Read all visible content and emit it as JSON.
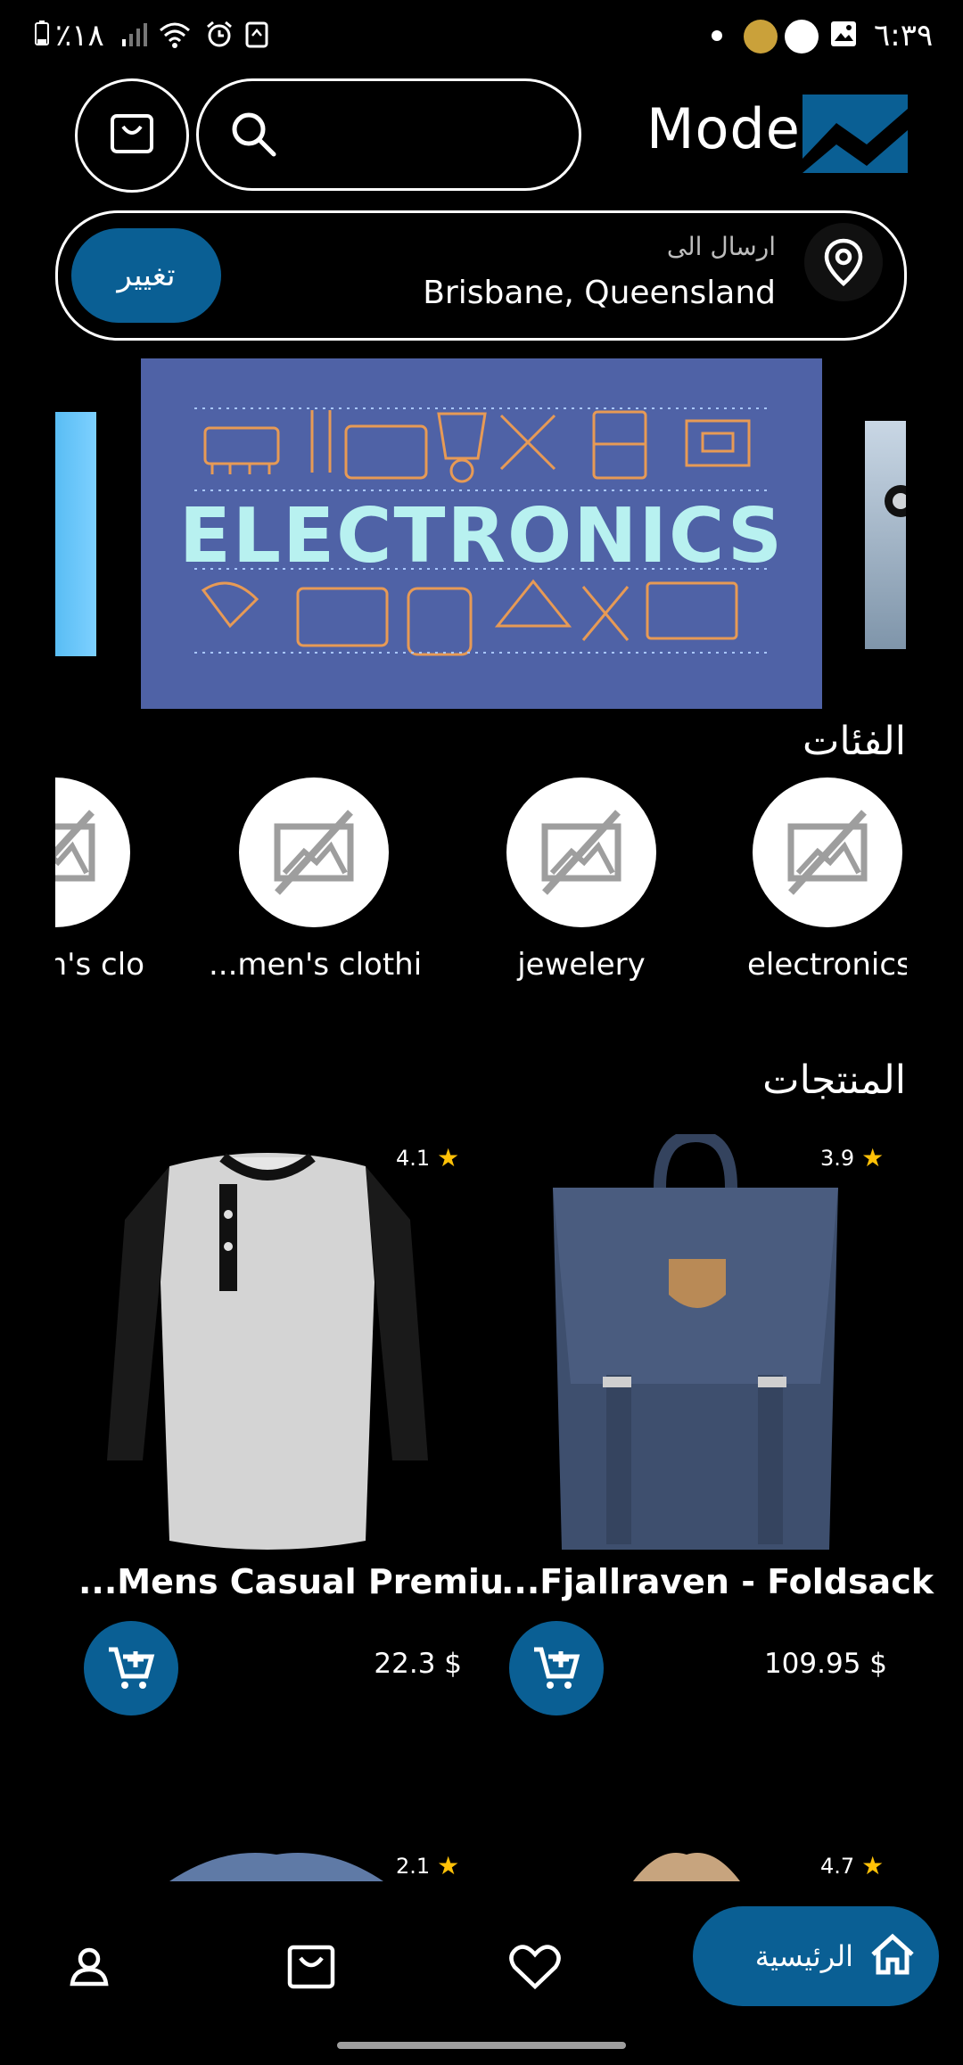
{
  "status": {
    "battery": "٪١٨",
    "time": "٦:٣٩"
  },
  "header": {
    "brand": "Modee",
    "search_placeholder": ""
  },
  "location": {
    "label": "ارسال الى",
    "address": "Brisbane, Queensland",
    "change_label": "تغيير"
  },
  "banner": {
    "title": "ELECTRONICS"
  },
  "sections": {
    "categories_title": "الفئات",
    "products_title": "المنتجات"
  },
  "categories": [
    {
      "label": "electronics"
    },
    {
      "label": "jewelery"
    },
    {
      "label": "...men's clothi"
    },
    {
      "label": "en's clo"
    }
  ],
  "products": [
    {
      "title": "...Mens Casual Premiu",
      "price": "22.3 $",
      "rating": "4.1"
    },
    {
      "title": "...Fjallraven - Foldsack",
      "price": "109.95 $",
      "rating": "3.9"
    },
    {
      "title": "",
      "price": "",
      "rating": "2.1"
    },
    {
      "title": "",
      "price": "",
      "rating": "4.7"
    }
  ],
  "nav": {
    "home_label": "الرئيسية"
  },
  "colors": {
    "accent": "#0a5f94",
    "banner_bg": "#4f62a6",
    "star": "#ffc107"
  }
}
